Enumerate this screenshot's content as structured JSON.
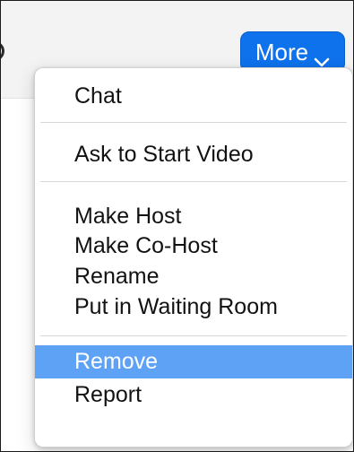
{
  "toolbar": {
    "more_label": "More"
  },
  "menu": {
    "items": [
      {
        "label": "Chat"
      },
      {
        "label": "Ask to Start Video"
      },
      {
        "label": "Make Host"
      },
      {
        "label": "Make Co-Host"
      },
      {
        "label": "Rename"
      },
      {
        "label": "Put in Waiting Room"
      },
      {
        "label": "Remove",
        "selected": true
      },
      {
        "label": "Report"
      }
    ]
  },
  "colors": {
    "accent": "#0e72ed",
    "selection": "#5ea2f6",
    "menu_bg": "#ffffff",
    "top_bar_bg": "#f3f3f3"
  },
  "icons": {
    "more_chevron": "chevron-down-icon"
  }
}
